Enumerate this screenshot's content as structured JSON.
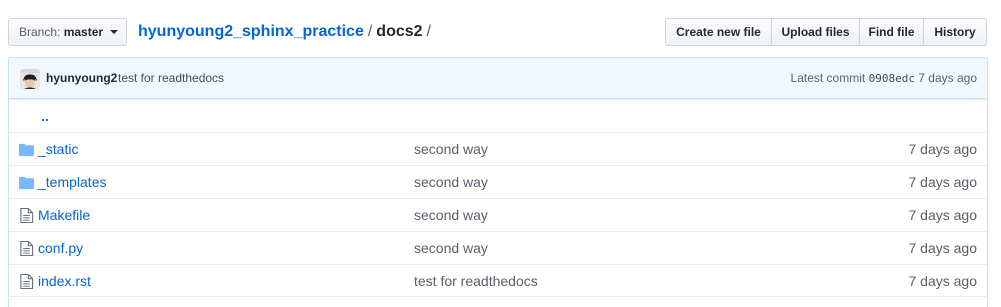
{
  "branch": {
    "prefix": "Branch:",
    "name": "master"
  },
  "breadcrumb": {
    "repo": "hyunyoung2_sphinx_practice",
    "sep1": "/",
    "current": "docs2",
    "sep2": "/"
  },
  "toolbar": {
    "create_new_file": "Create new file",
    "upload_files": "Upload files",
    "find_file": "Find file",
    "history": "History"
  },
  "commit": {
    "author": "hyunyoung2",
    "message": "test for readthedocs",
    "latest_label": "Latest commit",
    "sha": "0908edc",
    "age": "7 days ago"
  },
  "parent_dir": "..",
  "files": [
    {
      "name": "_static",
      "type": "directory",
      "icon": "folder-icon",
      "message": "second way",
      "age": "7 days ago"
    },
    {
      "name": "_templates",
      "type": "directory",
      "icon": "folder-icon",
      "message": "second way",
      "age": "7 days ago"
    },
    {
      "name": "Makefile",
      "type": "file",
      "icon": "file-icon",
      "message": "second way",
      "age": "7 days ago"
    },
    {
      "name": "conf.py",
      "type": "file",
      "icon": "file-icon",
      "message": "second way",
      "age": "7 days ago"
    },
    {
      "name": "index.rst",
      "type": "file",
      "icon": "file-icon",
      "message": "test for readthedocs",
      "age": "7 days ago"
    }
  ],
  "colors": {
    "link": "#0366d6",
    "folder": "#79b8ff",
    "commit_bg": "#f1f8ff",
    "border": "#c8e1ff"
  }
}
